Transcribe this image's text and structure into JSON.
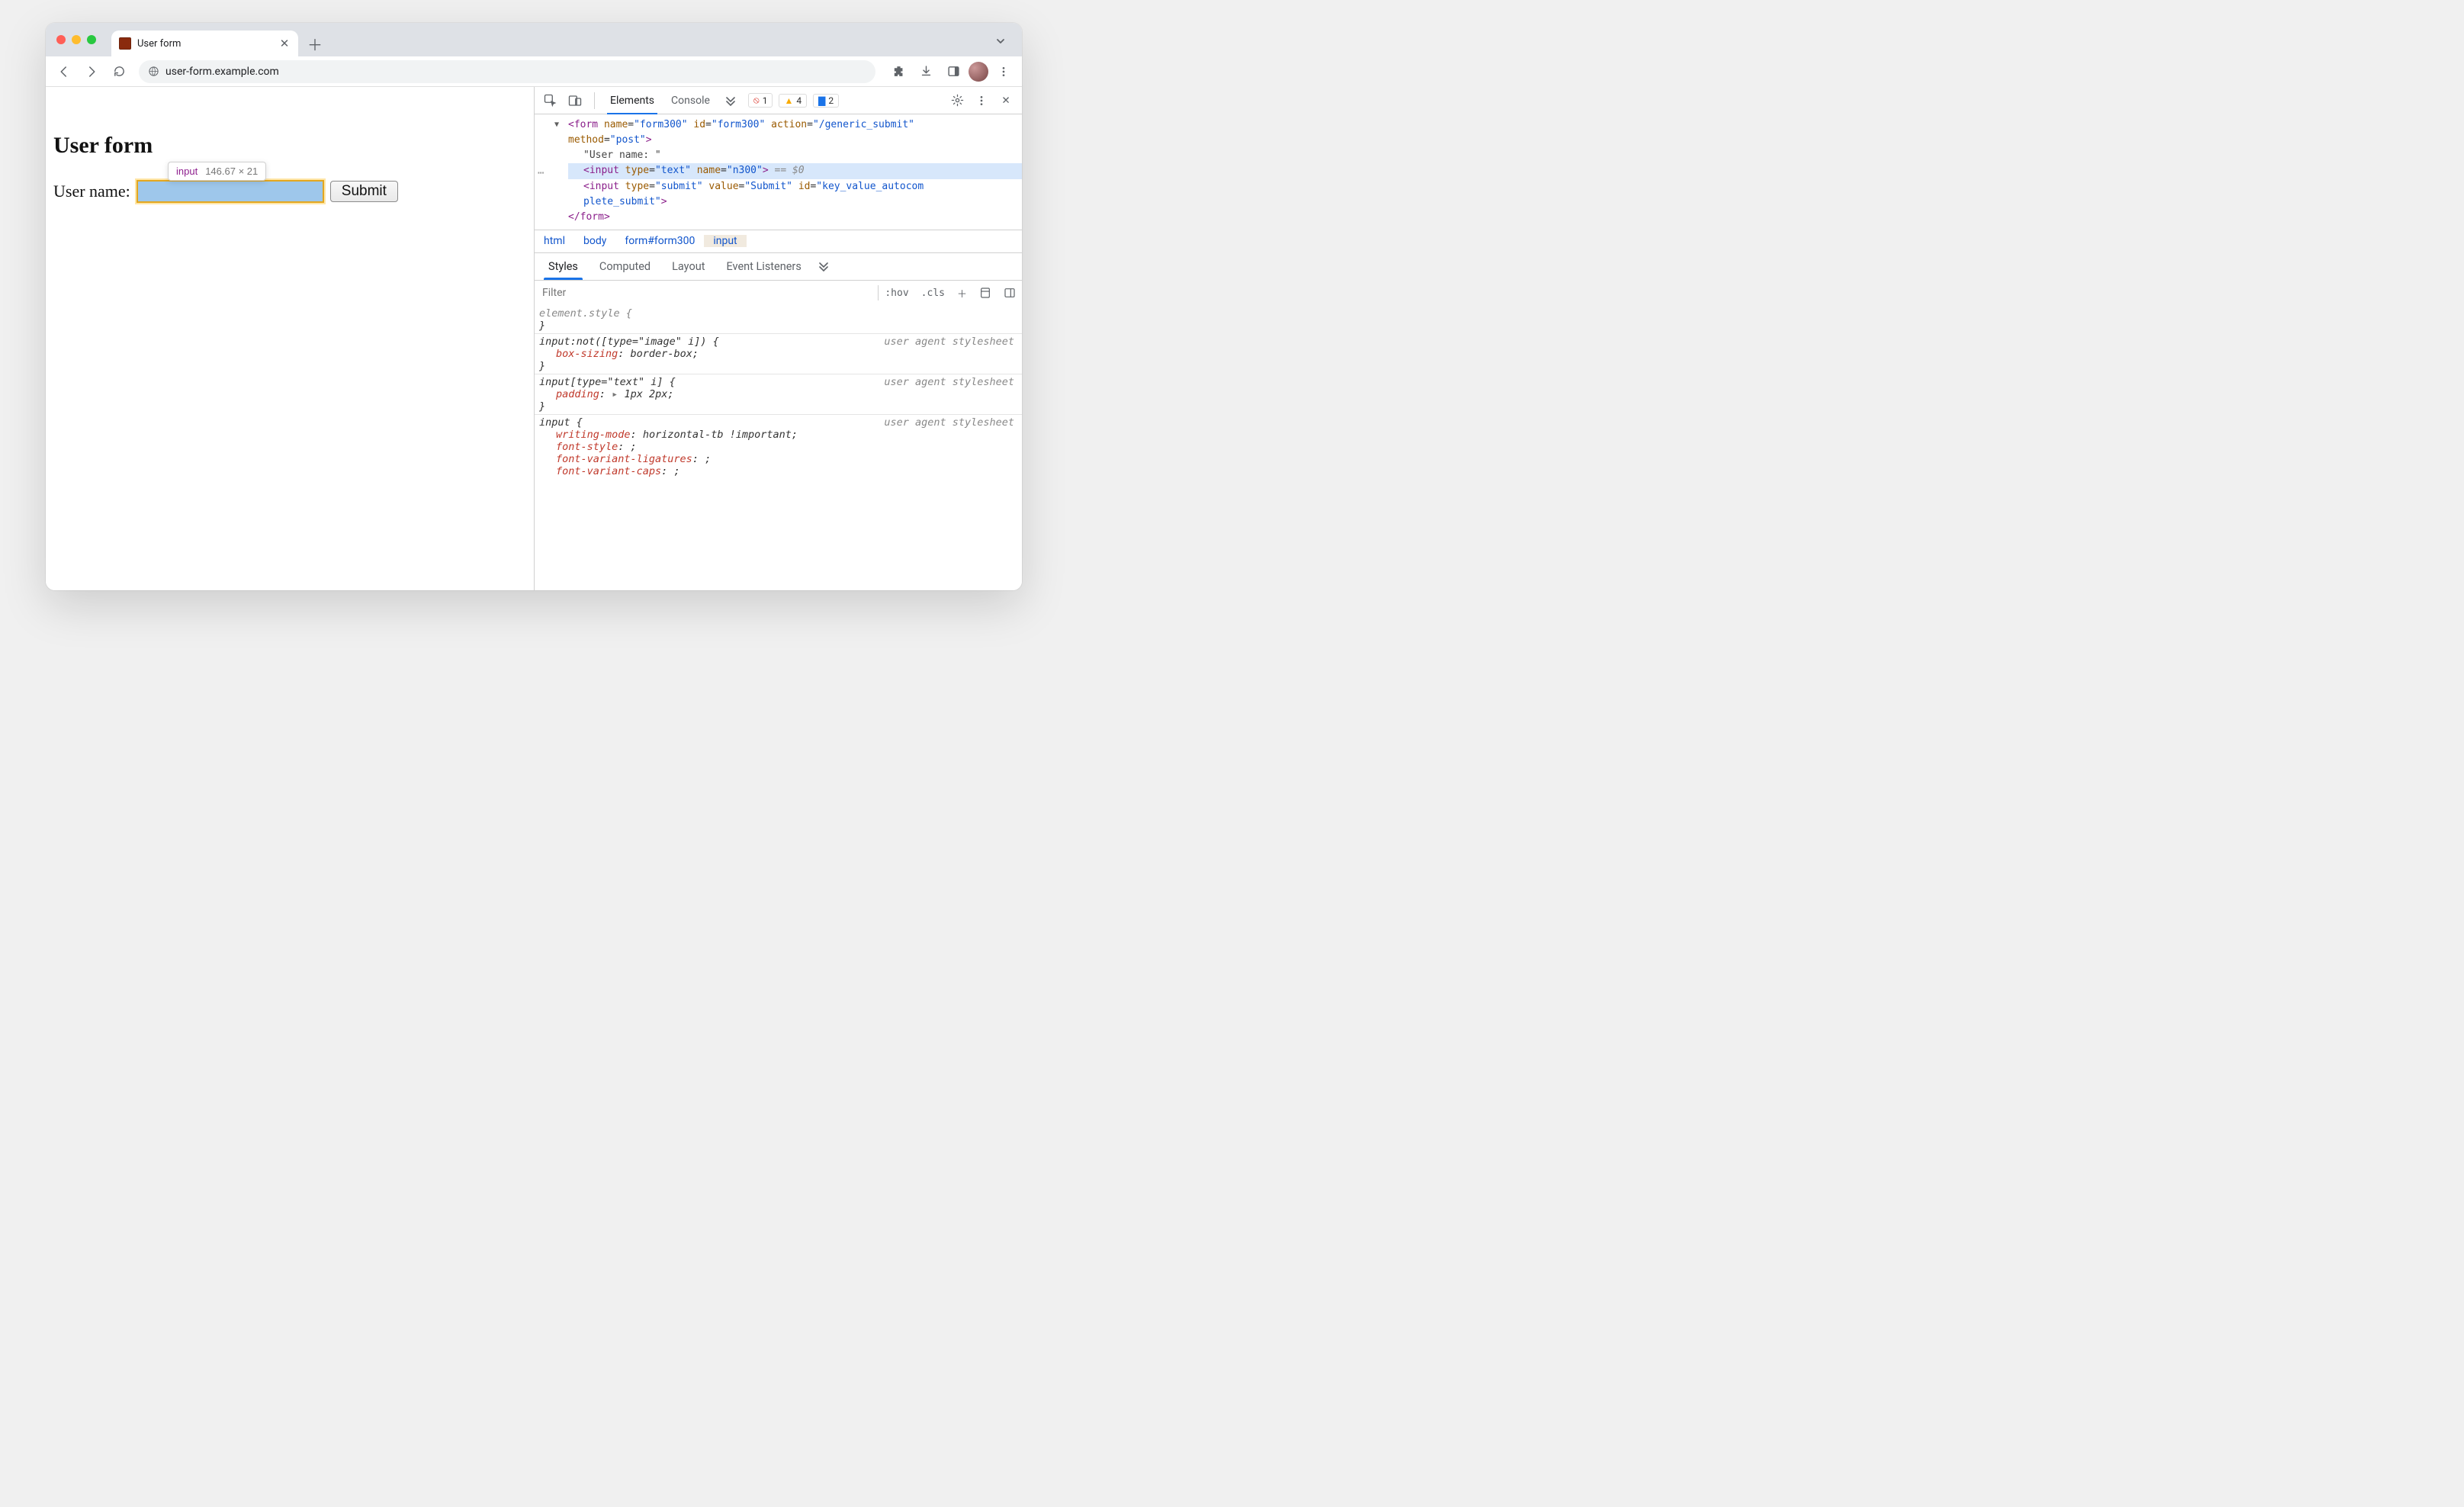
{
  "browser": {
    "tab_title": "User form",
    "url": "user-form.example.com"
  },
  "page": {
    "heading": "User form",
    "label_text": "User name:",
    "submit_label": "Submit",
    "tooltip_tag": "input",
    "tooltip_dims": "146.67 × 21"
  },
  "devtools": {
    "tabs": {
      "elements": "Elements",
      "console": "Console"
    },
    "counts": {
      "errors": "1",
      "warnings": "4",
      "issues": "2"
    },
    "dom": {
      "form_open_1": "<form name=\"form300\" id=\"form300\" action=\"/generic_submit\"",
      "form_open_2": "method=\"post\">",
      "text_node": "\"User name: \"",
      "input_text": "<input type=\"text\" name=\"n300\">",
      "eq_dollar": " == $0",
      "input_submit_1": "<input type=\"submit\" value=\"Submit\" id=\"key_value_autocom",
      "input_submit_2": "plete_submit\">",
      "form_close": "</form>"
    },
    "breadcrumb": {
      "b1": "html",
      "b2": "body",
      "b3": "form#form300",
      "b4": "input"
    },
    "styles_tabs": {
      "styles": "Styles",
      "computed": "Computed",
      "layout": "Layout",
      "listeners": "Event Listeners"
    },
    "filter_placeholder": "Filter",
    "toolbar": {
      "hov": ":hov",
      "cls": ".cls"
    },
    "rules": {
      "r0_sel": "element.style {",
      "r1_sel": "input:not([type=\"image\" i]) {",
      "r1_origin": "user agent stylesheet",
      "r1_p": "box-sizing",
      "r1_v": "border-box",
      "r2_sel": "input[type=\"text\" i] {",
      "r2_origin": "user agent stylesheet",
      "r2_p": "padding",
      "r2_v": "1px 2px",
      "r3_sel": "input {",
      "r3_origin": "user agent stylesheet",
      "r3_p1": "writing-mode",
      "r3_v1": "horizontal-tb !important",
      "r3_p2": "font-style",
      "r3_v2": "",
      "r3_p3": "font-variant-ligatures",
      "r3_v3": "",
      "r3_p4": "font-variant-caps",
      "r3_v4": ""
    }
  }
}
